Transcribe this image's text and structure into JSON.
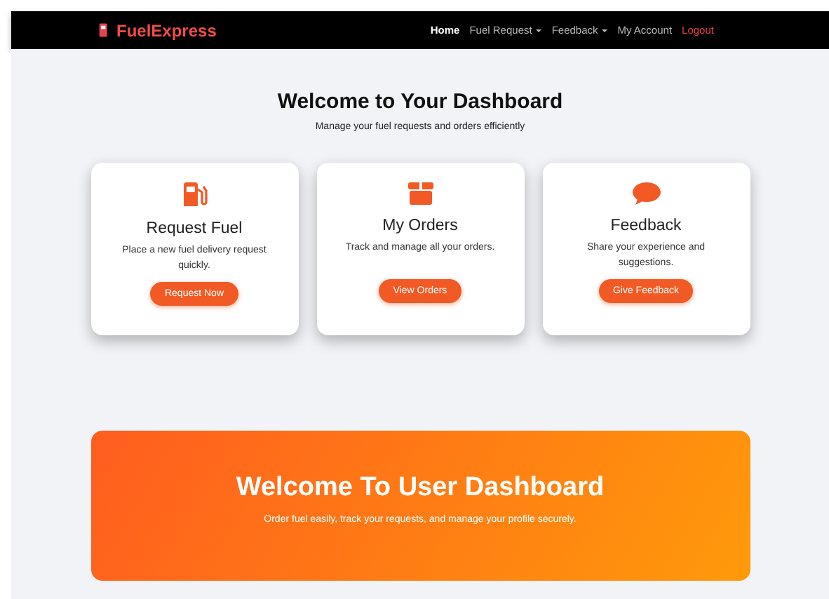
{
  "navbar": {
    "brand": "FuelExpress",
    "links": [
      {
        "label": "Home",
        "selected": true,
        "kind": "link"
      },
      {
        "label": "Fuel Request",
        "selected": false,
        "kind": "dropdown"
      },
      {
        "label": "Feedback",
        "selected": false,
        "kind": "dropdown"
      },
      {
        "label": "My Account",
        "selected": false,
        "kind": "link"
      },
      {
        "label": "Logout",
        "selected": false,
        "kind": "logout"
      }
    ]
  },
  "header": {
    "title": "Welcome to Your Dashboard",
    "subtitle": "Manage your fuel requests and orders efficiently"
  },
  "cards": [
    {
      "kind": "fuel",
      "title": "Request Fuel",
      "text": "Place a new fuel delivery request quickly.",
      "button": "Request Now"
    },
    {
      "kind": "box",
      "title": "My Orders",
      "text": "Track and manage all your orders.",
      "button": "View Orders"
    },
    {
      "kind": "chat",
      "title": "Feedback",
      "text": "Share your experience and suggestions.",
      "button": "Give Feedback"
    }
  ],
  "banner": {
    "title": "Welcome To User Dashboard",
    "text": "Order fuel easily, track your requests, and manage your profile securely."
  }
}
